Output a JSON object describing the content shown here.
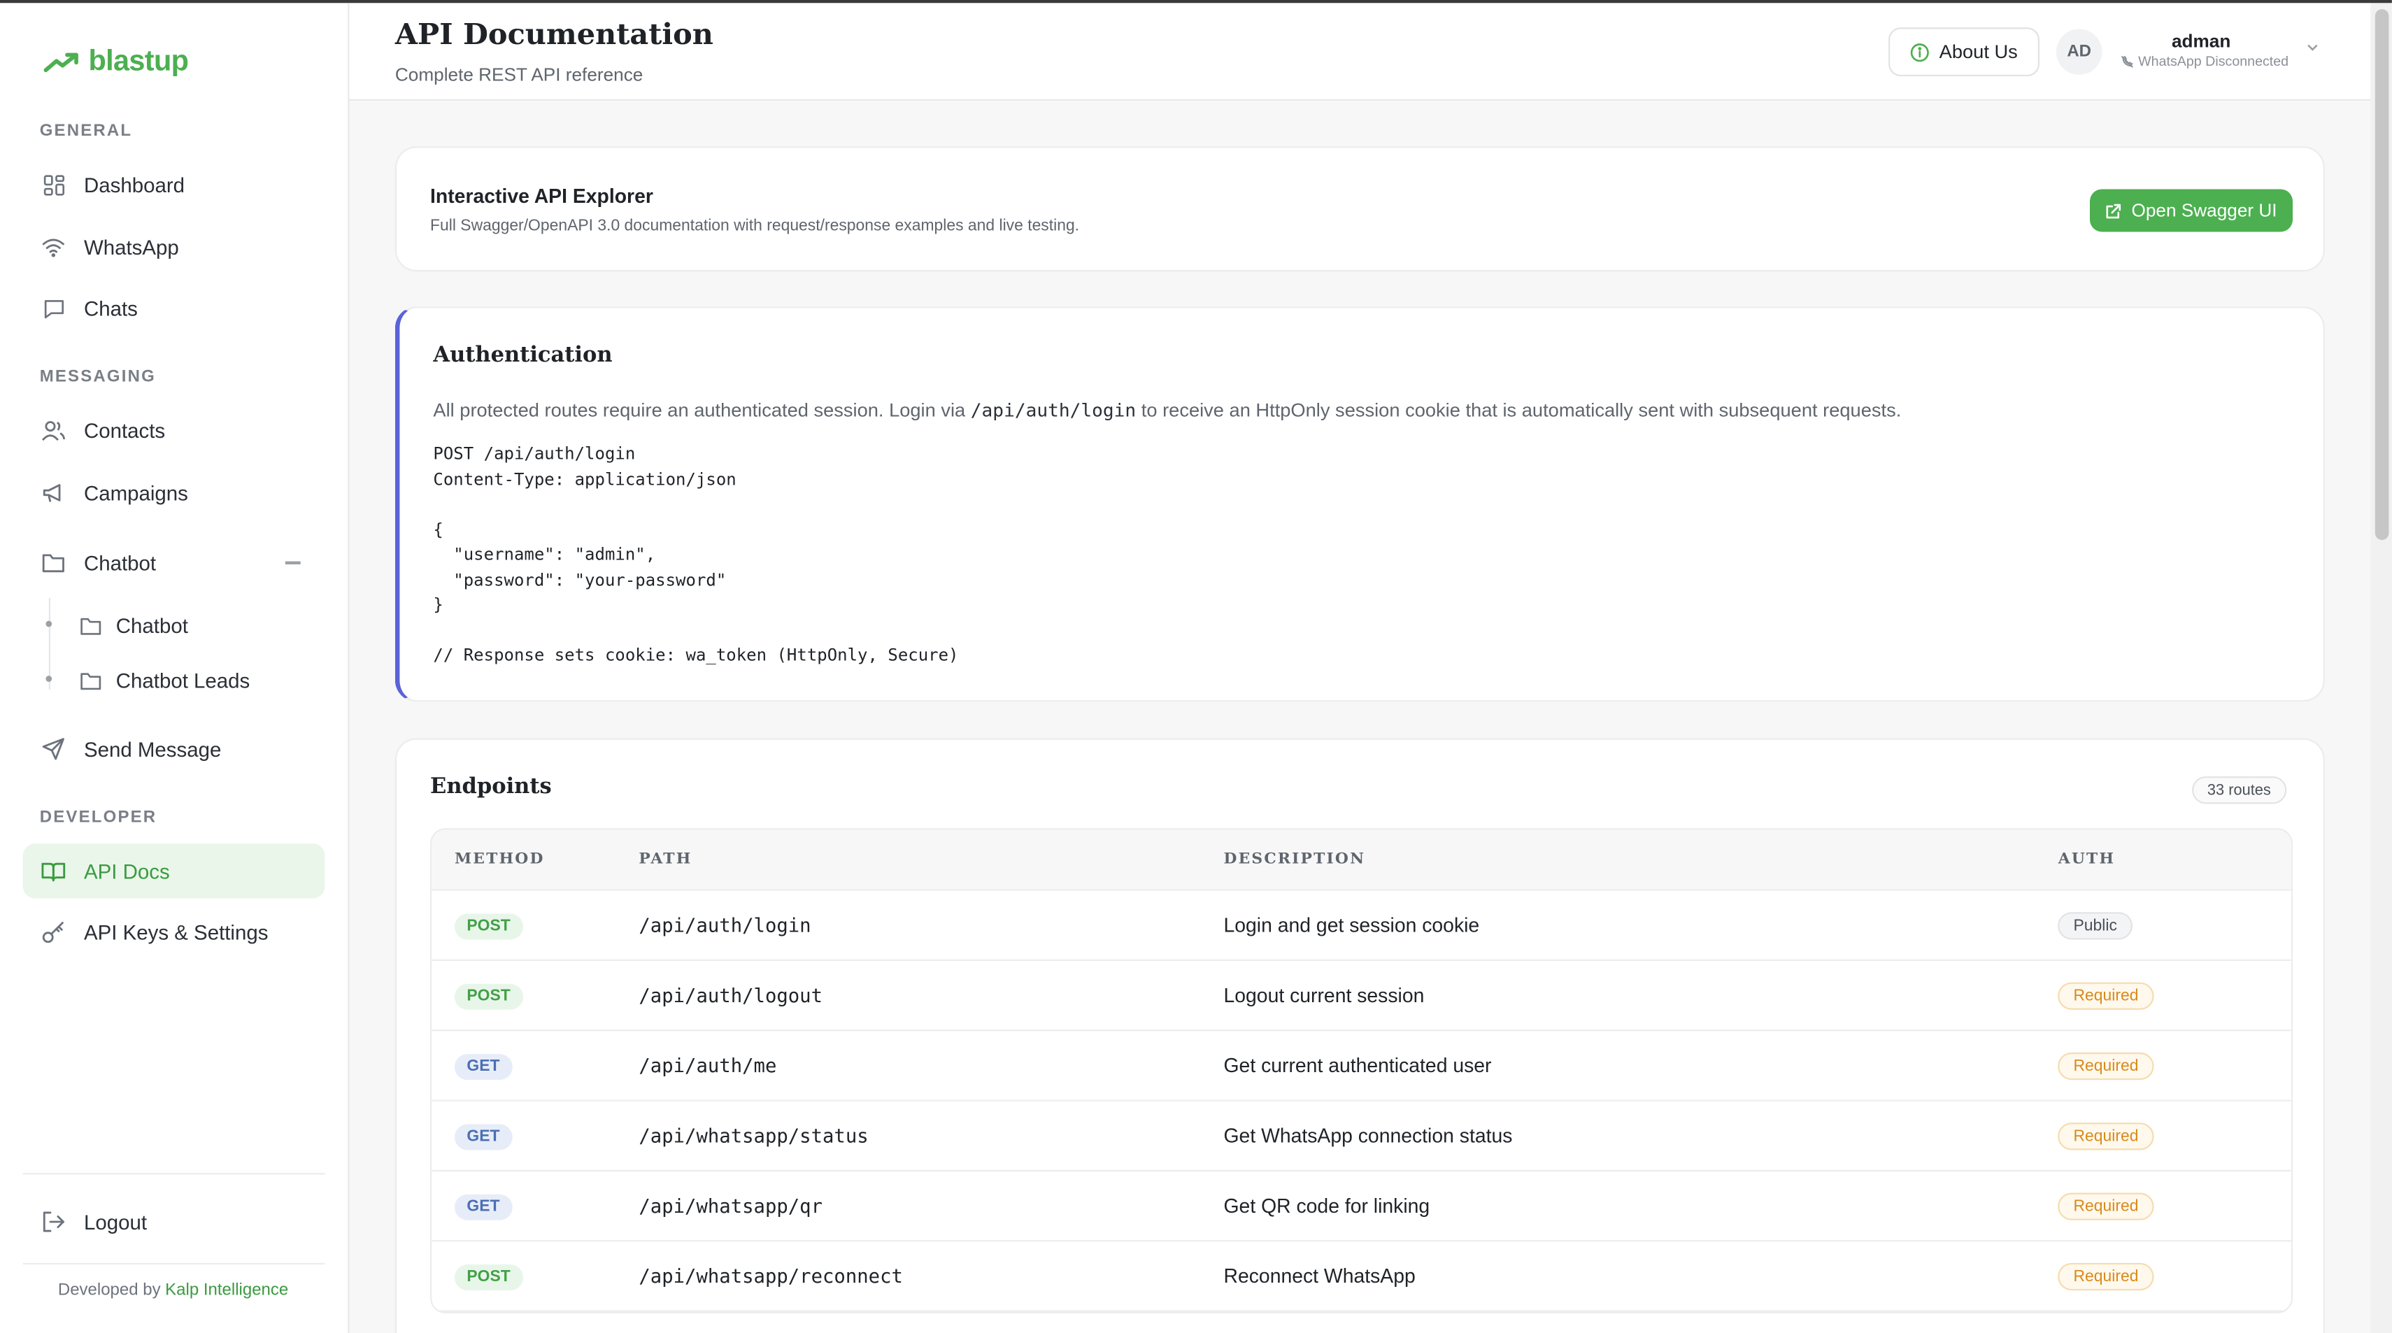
{
  "brand": {
    "name": "blastup",
    "color": "#4caf50"
  },
  "sidebar": {
    "sections": {
      "general": "GENERAL",
      "messaging": "MESSAGING",
      "developer": "DEVELOPER"
    },
    "items": {
      "dashboard": "Dashboard",
      "whatsapp": "WhatsApp",
      "chats": "Chats",
      "contacts": "Contacts",
      "campaigns": "Campaigns",
      "chatbot": "Chatbot",
      "chatbot_sub": "Chatbot",
      "chatbot_leads": "Chatbot Leads",
      "send_message": "Send Message",
      "api_docs": "API Docs",
      "api_keys": "API Keys & Settings",
      "logout": "Logout"
    },
    "footer": {
      "prefix": "Developed by",
      "company": "Kalp Intelligence"
    }
  },
  "header": {
    "title": "API Documentation",
    "subtitle": "Complete REST API reference",
    "about_label": "About Us",
    "avatar_initials": "AD",
    "user_name": "adman",
    "user_status": "WhatsApp Disconnected"
  },
  "explorer": {
    "title": "Interactive API Explorer",
    "description": "Full Swagger/OpenAPI 3.0 documentation with request/response examples and live testing.",
    "button_label": "Open Swagger UI"
  },
  "auth": {
    "title": "Authentication",
    "desc_before": "All protected routes require an authenticated session. Login via",
    "desc_code": "/api/auth/login",
    "desc_after": "to receive an HttpOnly session cookie that is automatically sent with subsequent requests.",
    "code": "POST /api/auth/login\nContent-Type: application/json\n\n{\n  \"username\": \"admin\",\n  \"password\": \"your-password\"\n}\n\n// Response sets cookie: wa_token (HttpOnly, Secure)"
  },
  "endpoints": {
    "title": "Endpoints",
    "count_label": "33 routes",
    "columns": {
      "method": "METHOD",
      "path": "PATH",
      "description": "DESCRIPTION",
      "auth": "AUTH"
    },
    "rows": [
      {
        "method": "POST",
        "path": "/api/auth/login",
        "description": "Login and get session cookie",
        "auth": "Public"
      },
      {
        "method": "POST",
        "path": "/api/auth/logout",
        "description": "Logout current session",
        "auth": "Required"
      },
      {
        "method": "GET",
        "path": "/api/auth/me",
        "description": "Get current authenticated user",
        "auth": "Required"
      },
      {
        "method": "GET",
        "path": "/api/whatsapp/status",
        "description": "Get WhatsApp connection status",
        "auth": "Required"
      },
      {
        "method": "GET",
        "path": "/api/whatsapp/qr",
        "description": "Get QR code for linking",
        "auth": "Required"
      },
      {
        "method": "POST",
        "path": "/api/whatsapp/reconnect",
        "description": "Reconnect WhatsApp",
        "auth": "Required"
      }
    ]
  },
  "colors": {
    "accent": "#4caf50",
    "auth_border": "#5b63d9",
    "get": "#4a6fb5",
    "required": "#d98a1a"
  }
}
